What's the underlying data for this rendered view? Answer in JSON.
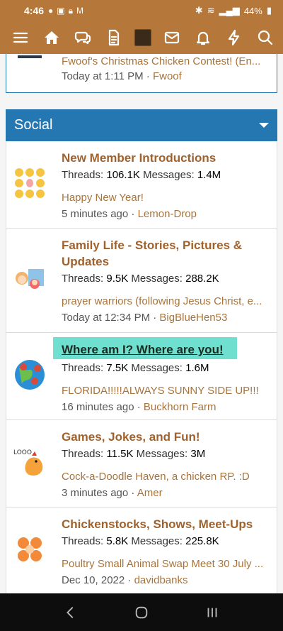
{
  "status": {
    "time": "4:46",
    "battery": "44%"
  },
  "prev_card": {
    "title": "Fwoof's Christmas Chicken Contest! (En...",
    "time": "Today at 1:11 PM",
    "user": "Fwoof"
  },
  "section": {
    "title": "Social"
  },
  "forums": [
    {
      "title": "New Member Introductions",
      "threads_label": "Threads:",
      "threads": "106.1K",
      "messages_label": "Messages:",
      "messages": "1.4M",
      "latest": "Happy New Year!",
      "time": "5 minutes ago",
      "user": "Lemon-Drop",
      "icon": "chick-grid-icon"
    },
    {
      "title": "Family Life - Stories, Pictures & Updates",
      "threads_label": "Threads:",
      "threads": "9.5K",
      "messages_label": "Messages:",
      "messages": "288.2K",
      "latest": "prayer warriors (following Jesus Christ, e...",
      "time": "Today at 12:34 PM",
      "user": "BigBlueHen53",
      "icon": "family-photo-icon"
    },
    {
      "title": "Where am I? Where are you!",
      "threads_label": "Threads:",
      "threads": "7.5K",
      "messages_label": "Messages:",
      "messages": "1.6M",
      "latest": "FLORIDA!!!!!ALWAYS SUNNY SIDE UP!!!",
      "time": "16 minutes ago",
      "user": "Buckhorn Farm",
      "icon": "globe-chickens-icon"
    },
    {
      "title": "Games, Jokes, and Fun!",
      "threads_label": "Threads:",
      "threads": "11.5K",
      "messages_label": "Messages:",
      "messages": "3M",
      "latest": "Cock-a-Doodle Haven, a chicken RP. :D",
      "time": "3 minutes ago",
      "user": "Amer",
      "icon": "rooster-crow-icon"
    },
    {
      "title": "Chickenstocks, Shows, Meet-Ups",
      "threads_label": "Threads:",
      "threads": "5.8K",
      "messages_label": "Messages:",
      "messages": "225.8K",
      "latest": "Poultry Small Animal Swap Meet 30 July ...",
      "time": "Dec 10, 2022",
      "user": "davidbanks",
      "icon": "chickens-meetup-icon"
    }
  ],
  "colors": {
    "nav": "#b5773a",
    "section": "#2577b1",
    "highlight": "#6fe0cf",
    "title": "#a0622d"
  }
}
